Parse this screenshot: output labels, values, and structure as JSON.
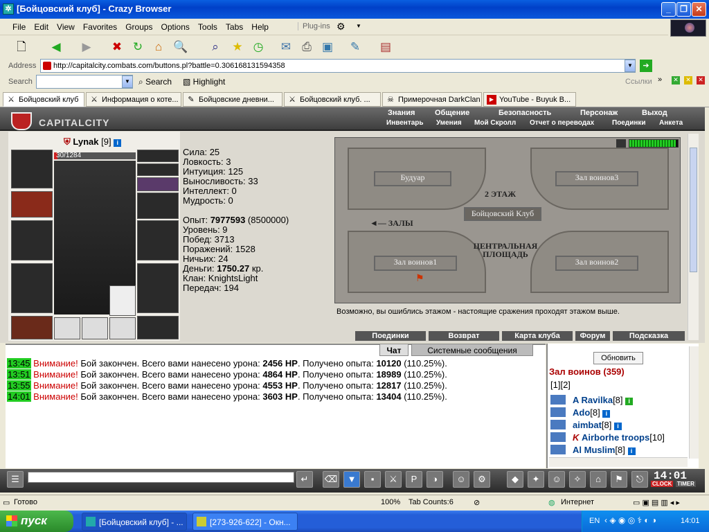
{
  "window": {
    "title": "[Бойцовский клуб] - Crazy Browser"
  },
  "menu": [
    "File",
    "Edit",
    "View",
    "Favorites",
    "Groups",
    "Options",
    "Tools",
    "Tabs",
    "Help"
  ],
  "plugins_label": "Plug-ins",
  "address": {
    "label": "Address",
    "url": "http://capitalcity.combats.com/buttons.pl?battle=0.306168131594358"
  },
  "links_label": "Ссылки",
  "search": {
    "label": "Search",
    "button": "Search",
    "highlight": "Highlight"
  },
  "tabs": [
    {
      "label": "Бойцовский клуб",
      "active": true
    },
    {
      "label": "Информация о коте..."
    },
    {
      "label": "Бойцовские дневни..."
    },
    {
      "label": "Бойцовский клуб. ..."
    },
    {
      "label": "Примерочная DarkClan"
    },
    {
      "label": "YouTube - Buyuk B..."
    }
  ],
  "game": {
    "brand": "CAPITALCITY",
    "nav_top": [
      "Знания",
      "Общение",
      "Безопасность",
      "Персонаж",
      "Выход"
    ],
    "nav_bottom": [
      "Инвентарь",
      "Умения",
      "Мой Скролл",
      "Отчет о переводах",
      "Поединки",
      "Анкета"
    ],
    "character": {
      "name": "Lynak",
      "level": "[9]",
      "hp": "30/1284"
    },
    "stats": [
      {
        "k": "Сила: ",
        "v": "25"
      },
      {
        "k": "Ловкость: ",
        "v": "3"
      },
      {
        "k": "Интуиция: ",
        "v": "125"
      },
      {
        "k": "Выносливость: ",
        "v": "33"
      },
      {
        "k": "Интеллект: ",
        "v": "0"
      },
      {
        "k": "Мудрость: ",
        "v": "0"
      }
    ],
    "progress": {
      "exp_label": "Опыт: ",
      "exp": "7977593",
      "exp_next": " (8500000)",
      "level": "Уровень: 9",
      "wins": "Побед: 3713",
      "losses": "Поражений: 1528",
      "draws": "Ничьих: 24",
      "money_label": "Деньги: ",
      "money": "1750.27",
      "money_unit": " кр.",
      "clan": "Клан: KnightsLight",
      "transfers": "Передач: 194"
    },
    "map": {
      "floor": "2 ЭТАЖ",
      "club": "Бойцовский Клуб",
      "halls": "ЗАЛЫ",
      "center": "ЦЕНТРАЛЬНАЯ ПЛОЩАДЬ",
      "rooms": [
        "Будуар",
        "Зал воинов3",
        "Зал воинов1",
        "Зал воинов2"
      ]
    },
    "note": "Возможно, вы ошиблись этажом - настоящие сражения проходят этажом выше.",
    "buttons": [
      "Поединки",
      "Возврат",
      "Карта клуба",
      "Форум",
      "Подсказка"
    ]
  },
  "chat": {
    "tabs": [
      "Чат",
      "Системные сообщения"
    ],
    "messages": [
      {
        "time": "13:45",
        "warn": "Внимание!",
        "text": " Бой закончен. Всего вами нанесено урона: ",
        "dmg": "2456 HP",
        "text2": ". Получено опыта: ",
        "exp": "10120",
        "pct": " (110.25%)."
      },
      {
        "time": "13:51",
        "warn": "Внимание!",
        "text": " Бой закончен. Всего вами нанесено урона: ",
        "dmg": "4864 HP",
        "text2": ". Получено опыта: ",
        "exp": "18989",
        "pct": " (110.25%)."
      },
      {
        "time": "13:55",
        "warn": "Внимание!",
        "text": " Бой закончен. Всего вами нанесено урона: ",
        "dmg": "4553 HP",
        "text2": ". Получено опыта: ",
        "exp": "12817",
        "pct": " (110.25%)."
      },
      {
        "time": "14:01",
        "warn": "Внимание!",
        "text": " Бой закончен. Всего вами нанесено урона: ",
        "dmg": "3603 HP",
        "text2": ". Получено опыта: ",
        "exp": "13404",
        "pct": " (110.25%)."
      }
    ]
  },
  "room": {
    "refresh": "Обновить",
    "title": "Зал воинов (359)",
    "pages": "[1][2]",
    "players": [
      {
        "name": "A Ravilka",
        "lvl": "[8]"
      },
      {
        "name": "Ado",
        "lvl": "[8]"
      },
      {
        "name": "aimbat",
        "lvl": "[8]"
      },
      {
        "name": "Airborhe troops",
        "lvl": "[10]"
      },
      {
        "name": "Al Muslim",
        "lvl": "[8]"
      }
    ]
  },
  "clock": "14:01",
  "clock_labels": [
    "CLOCK",
    "TIMER"
  ],
  "status": {
    "ready": "Готово",
    "zoom": "100%",
    "tabcount": "Tab Counts:6",
    "zone": "Интернет"
  },
  "taskbar": {
    "start": "пуск",
    "tasks": [
      {
        "label": "[Бойцовский клуб] - ..."
      },
      {
        "label": "[273-926-622] - Окн..."
      }
    ],
    "lang": "EN",
    "time": "14:01"
  }
}
